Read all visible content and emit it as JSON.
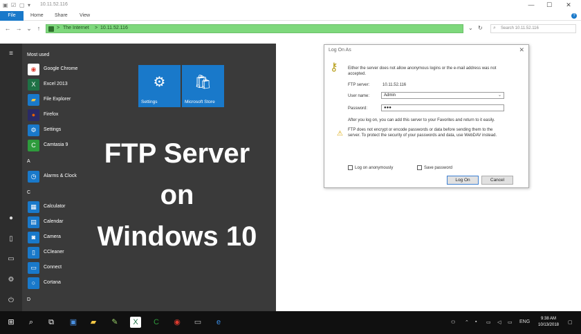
{
  "window": {
    "title": "10.11.52.116",
    "controls": {
      "minimize": "—",
      "maximize": "☐",
      "close": "✕"
    }
  },
  "ribbon": {
    "tabs": [
      "File",
      "Home",
      "Share",
      "View"
    ],
    "help": "?"
  },
  "address_bar": {
    "back": "←",
    "forward": "→",
    "recent": "⌄",
    "up": "↑",
    "crumbs": [
      "The Internet",
      "10.11.52.116"
    ],
    "separator": ">",
    "dropdown": "⌄",
    "refresh": "↻",
    "search_placeholder": "Search 10.11.52.116"
  },
  "start_menu": {
    "rail_icons": [
      "hamburger-icon",
      "user-icon",
      "document-icon",
      "pictures-icon",
      "settings-icon",
      "power-icon"
    ],
    "most_used_header": "Most used",
    "most_used": [
      {
        "label": "Google Chrome",
        "icon": "chrome-icon",
        "color": "#de3b2f"
      },
      {
        "label": "Excel 2013",
        "icon": "excel-icon",
        "color": "#1e7145"
      },
      {
        "label": "File Explorer",
        "icon": "folder-icon",
        "color": "#1979ca"
      },
      {
        "label": "Firefox",
        "icon": "firefox-icon",
        "color": "#e66000"
      },
      {
        "label": "Settings",
        "icon": "gear-icon",
        "color": "#1979ca"
      },
      {
        "label": "Camtasia 9",
        "icon": "camtasia-icon",
        "color": "#2e9b3c"
      }
    ],
    "section_a": "A",
    "a_apps": [
      {
        "label": "Alarms & Clock",
        "icon": "alarm-icon",
        "color": "#1979ca"
      }
    ],
    "section_c": "C",
    "c_apps": [
      {
        "label": "Calculator",
        "icon": "calculator-icon",
        "color": "#1979ca"
      },
      {
        "label": "Calendar",
        "icon": "calendar-icon",
        "color": "#1979ca"
      },
      {
        "label": "Camera",
        "icon": "camera-icon",
        "color": "#1979ca"
      },
      {
        "label": "CCleaner",
        "icon": "ccleaner-icon",
        "color": "#1979ca"
      },
      {
        "label": "Connect",
        "icon": "connect-icon",
        "color": "#1979ca"
      },
      {
        "label": "Cortana",
        "icon": "cortana-icon",
        "color": "#1979ca"
      }
    ],
    "section_d": "D",
    "tiles": [
      {
        "label": "Settings",
        "icon": "gear-icon"
      },
      {
        "label": "Microsoft Store",
        "icon": "store-icon"
      }
    ],
    "headline": [
      "FTP Server",
      "on",
      "Windows 10"
    ]
  },
  "dialog": {
    "title": "Log On As",
    "close": "✕",
    "message_line1": "Either the server does not allow anonymous logins or the e-mail address was not",
    "message_line2": "accepted.",
    "ftp_server_label": "FTP server:",
    "ftp_server_value": "10.11.52.116",
    "username_label": "User name:",
    "username_value": "Admin",
    "password_label": "Password:",
    "password_value": "●●●",
    "after_logon": "After you log on, you can add this server to your Favorites and return to it easily.",
    "warning_line1": "FTP does not encrypt or encode passwords or data before sending them to the",
    "warning_line2": "server.  To protect the security of your passwords and data, use WebDAV instead.",
    "anonymous_label": "Log on anonymously",
    "save_password_label": "Save password",
    "logon_button": "Log On",
    "cancel_button": "Cancel"
  },
  "taskbar": {
    "icons": [
      {
        "name": "windows-start-icon",
        "color": "#ffffff"
      },
      {
        "name": "search-icon",
        "color": "#ffffff"
      },
      {
        "name": "task-view-icon",
        "color": "#ffffff"
      },
      {
        "name": "network-app-icon",
        "color": "#4a90e2"
      },
      {
        "name": "file-explorer-icon",
        "color": "#f2c744"
      },
      {
        "name": "paint-icon",
        "color": "#9bd36a"
      },
      {
        "name": "excel-icon",
        "color": "#1e7145"
      },
      {
        "name": "camtasia-icon",
        "color": "#2e9b3c"
      },
      {
        "name": "chrome-icon",
        "color": "#de3b2f"
      },
      {
        "name": "terminal-icon",
        "color": "#bbbbbb"
      },
      {
        "name": "edge-icon",
        "color": "#3a8ee6"
      }
    ],
    "tray": {
      "language": "ENG",
      "time": "9:38 AM",
      "date": "10/13/2018"
    }
  }
}
